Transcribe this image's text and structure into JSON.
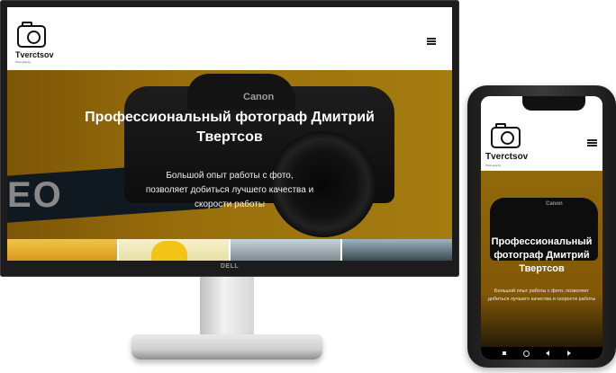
{
  "monitor": {
    "brand": "DELL"
  },
  "desktop_site": {
    "logo": {
      "name": "Tverctsov",
      "subtitle": "Photography",
      "icon": "camera-icon"
    },
    "menu_icon": "hamburger-menu-icon",
    "hero": {
      "title": "Профессиональный фотограф Дмитрий Твертсов",
      "subtitle": "Большой опыт работы с фото, позволяет добиться лучшего качества и скорости работы",
      "camera_brand": "Canon",
      "strap_text": "EO"
    },
    "gallery": [
      "photo-1",
      "photo-2",
      "photo-3",
      "photo-4"
    ]
  },
  "mobile_site": {
    "logo": {
      "name": "Tverctsov",
      "subtitle": "Photography",
      "icon": "camera-icon"
    },
    "menu_icon": "hamburger-menu-icon",
    "hero": {
      "title": "Профессиональный фотограф Дмитрий Твертсов",
      "subtitle": "Большой опыт работы с фото, позволяет добиться лучшего качества и скорости работы",
      "camera_brand": "Canon"
    },
    "nav_icons": [
      "recent-apps-icon",
      "home-icon",
      "back-icon",
      "menu-icon"
    ]
  }
}
